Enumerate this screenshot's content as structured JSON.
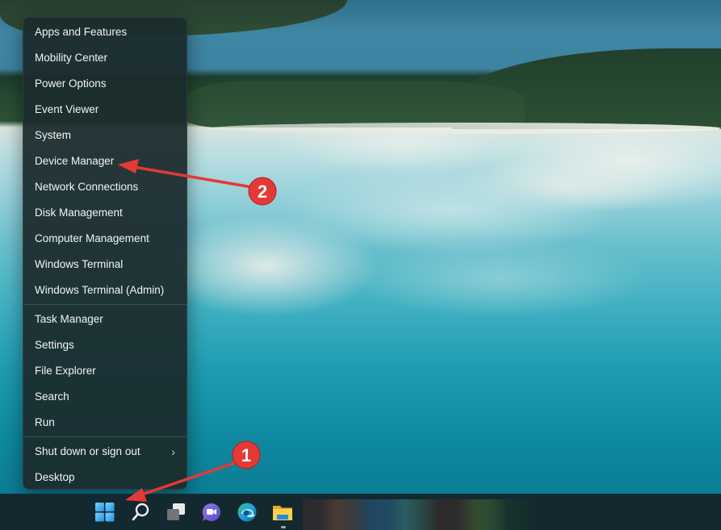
{
  "context_menu": {
    "groups": [
      [
        {
          "label": "Apps and Features"
        },
        {
          "label": "Mobility Center"
        },
        {
          "label": "Power Options"
        },
        {
          "label": "Event Viewer"
        },
        {
          "label": "System"
        },
        {
          "label": "Device Manager"
        },
        {
          "label": "Network Connections"
        },
        {
          "label": "Disk Management"
        },
        {
          "label": "Computer Management"
        },
        {
          "label": "Windows Terminal"
        },
        {
          "label": "Windows Terminal (Admin)"
        }
      ],
      [
        {
          "label": "Task Manager"
        },
        {
          "label": "Settings"
        },
        {
          "label": "File Explorer"
        },
        {
          "label": "Search"
        },
        {
          "label": "Run"
        }
      ],
      [
        {
          "label": "Shut down or sign out",
          "submenu_icon": "chevron-right-icon",
          "submenu_glyph": "›"
        },
        {
          "label": "Desktop"
        }
      ]
    ]
  },
  "taskbar": {
    "icons": [
      {
        "name": "start-button",
        "icon": "windows-logo-icon"
      },
      {
        "name": "search-button",
        "icon": "search-icon"
      },
      {
        "name": "task-view-button",
        "icon": "task-view-icon"
      },
      {
        "name": "chat-button",
        "icon": "teams-chat-icon"
      },
      {
        "name": "edge-button",
        "icon": "edge-browser-icon"
      },
      {
        "name": "file-explorer-button",
        "icon": "folder-icon",
        "running": true
      }
    ]
  },
  "annotations": [
    {
      "number": "1",
      "label": "1",
      "target": "start-button"
    },
    {
      "number": "2",
      "label": "2",
      "target": "Device Manager"
    }
  ],
  "colors": {
    "annotation_red": "#e53935",
    "menu_background": "#1c2c2e",
    "taskbar_background": "#14292f",
    "windows_accent": "#3aa0e8"
  }
}
